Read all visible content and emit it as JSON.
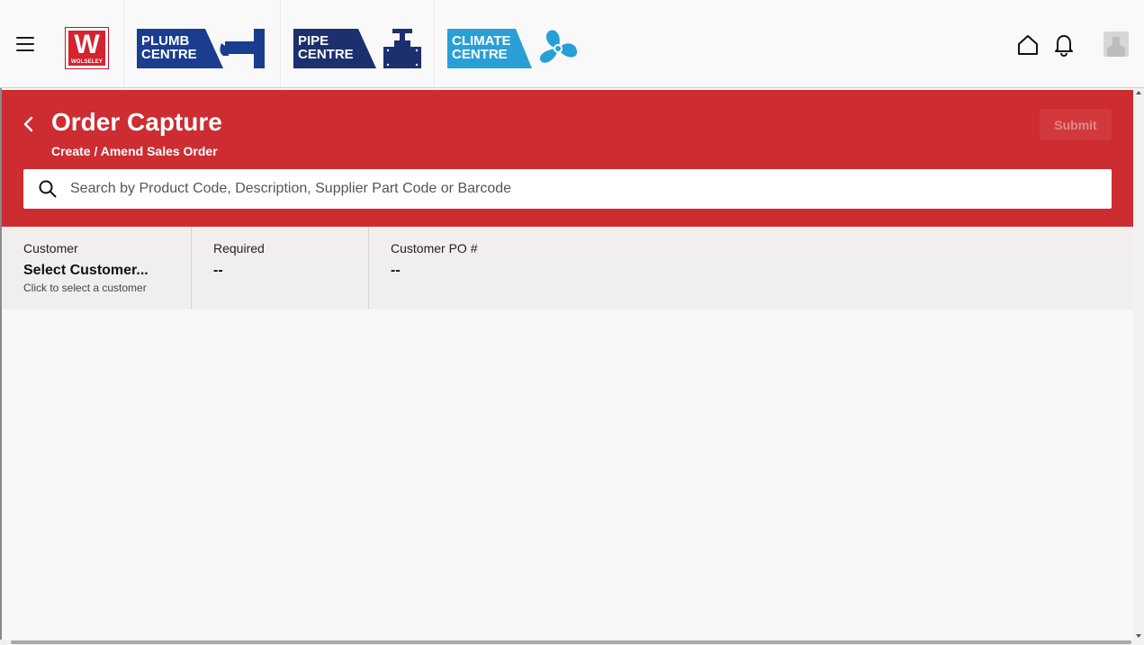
{
  "topbar": {
    "menu_icon": "hamburger-icon",
    "logos": {
      "wolseley": {
        "letter": "W",
        "text": "WOLSELEY",
        "color": "#d5232f"
      },
      "plumb_centre": {
        "line1": "PLUMB",
        "line2": "CENTRE",
        "color": "#1b3d8f"
      },
      "pipe_centre": {
        "line1": "PIPE",
        "line2": "CENTRE",
        "color": "#1c2f6e"
      },
      "climate_centre": {
        "line1": "CLIMATE",
        "line2": "CENTRE",
        "color": "#2a9fd6"
      }
    },
    "home_icon": "home-icon",
    "bell_icon": "bell-icon",
    "avatar_icon": "user-avatar-icon"
  },
  "header": {
    "title": "Order Capture",
    "subtitle": "Create / Amend Sales Order",
    "submit_label": "Submit",
    "background": "#cd2c31",
    "back_icon": "chevron-left-icon"
  },
  "search": {
    "placeholder": "Search by Product Code, Description, Supplier Part Code or Barcode",
    "value": "",
    "icon": "search-icon"
  },
  "info": {
    "customer": {
      "label": "Customer",
      "value": "Select Customer...",
      "hint": "Click to select a customer"
    },
    "required": {
      "label": "Required",
      "value": "--"
    },
    "customer_po": {
      "label": "Customer PO #",
      "value": "--"
    }
  }
}
